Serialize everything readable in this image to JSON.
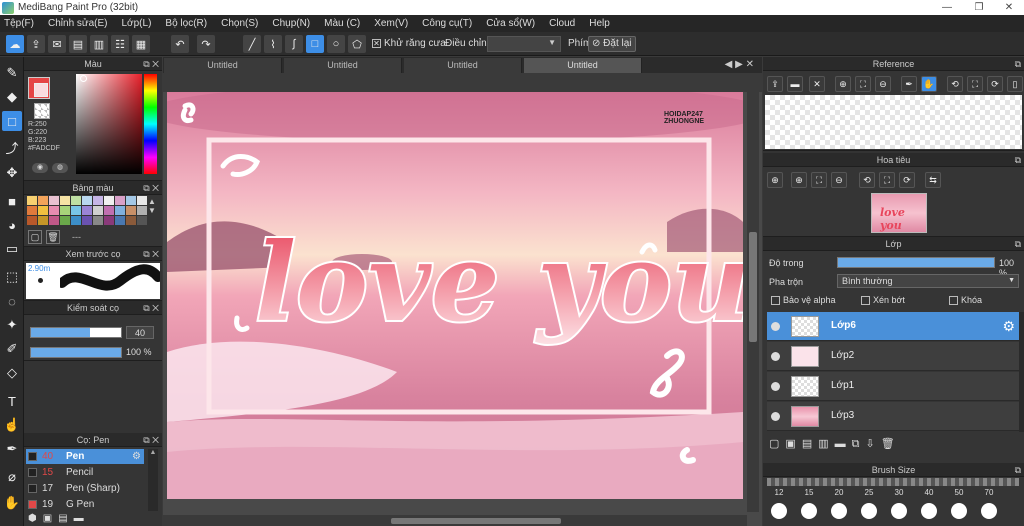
{
  "app": {
    "title": "MediBang Paint Pro (32bit)"
  },
  "menu": [
    "Tệp(F)",
    "Chỉnh sửa(E)",
    "Lớp(L)",
    "Bộ lọc(R)",
    "Chọn(S)",
    "Chụp(N)",
    "Màu (C)",
    "Xem(V)",
    "Công cụ(T)",
    "Cửa sổ(W)",
    "Cloud",
    "Help"
  ],
  "toolbar": {
    "antialias": "Khử răng cưa",
    "adjust": "Điều chỉnh",
    "key": "Phím",
    "reset": "Đặt lại"
  },
  "tabs": [
    "Untitled",
    "Untitled",
    "Untitled",
    "Untitled"
  ],
  "color_panel": {
    "title": "Màu",
    "r": "R:250",
    "g": "G:220",
    "b": "B:223",
    "hex": "#FADCDF",
    "fg_color": "#FADCDF"
  },
  "palette": {
    "title": "Bảng màu",
    "dash": "---"
  },
  "brush_preview": {
    "title": "Xem trước cọ",
    "size": "2.90m"
  },
  "brush_control": {
    "title": "Kiểm soát cọ",
    "size": "40",
    "opacity": "100 %"
  },
  "pen_panel": {
    "title": "Cọ: Pen",
    "items": [
      {
        "num": "40",
        "name": "Pen",
        "color": "#e04848"
      },
      {
        "num": "15",
        "name": "Pencil",
        "color": "#e04848"
      },
      {
        "num": "17",
        "name": "Pen (Sharp)",
        "color": "#dddddd"
      },
      {
        "num": "19",
        "name": "G Pen",
        "color": "#dddddd"
      }
    ]
  },
  "canvas": {
    "watermark_line1": "HOIDAP247",
    "watermark_line2": "ZHUONGNE",
    "text": "love you"
  },
  "reference": {
    "title": "Reference"
  },
  "navigator": {
    "title": "Hoa tiêu"
  },
  "layers": {
    "title": "Lớp",
    "opacity_label": "Độ trong",
    "opacity_value": "100 %",
    "blend_label": "Pha trộn",
    "blend_value": "Bình thường",
    "protect_alpha": "Bảo vệ alpha",
    "clipping": "Xén bớt",
    "lock": "Khóa",
    "items": [
      "Lớp6",
      "Lớp2",
      "Lớp1",
      "Lớp3"
    ]
  },
  "brush_size": {
    "title": "Brush Size",
    "sizes": [
      "12",
      "15",
      "20",
      "25",
      "30",
      "40",
      "50",
      "70"
    ]
  }
}
